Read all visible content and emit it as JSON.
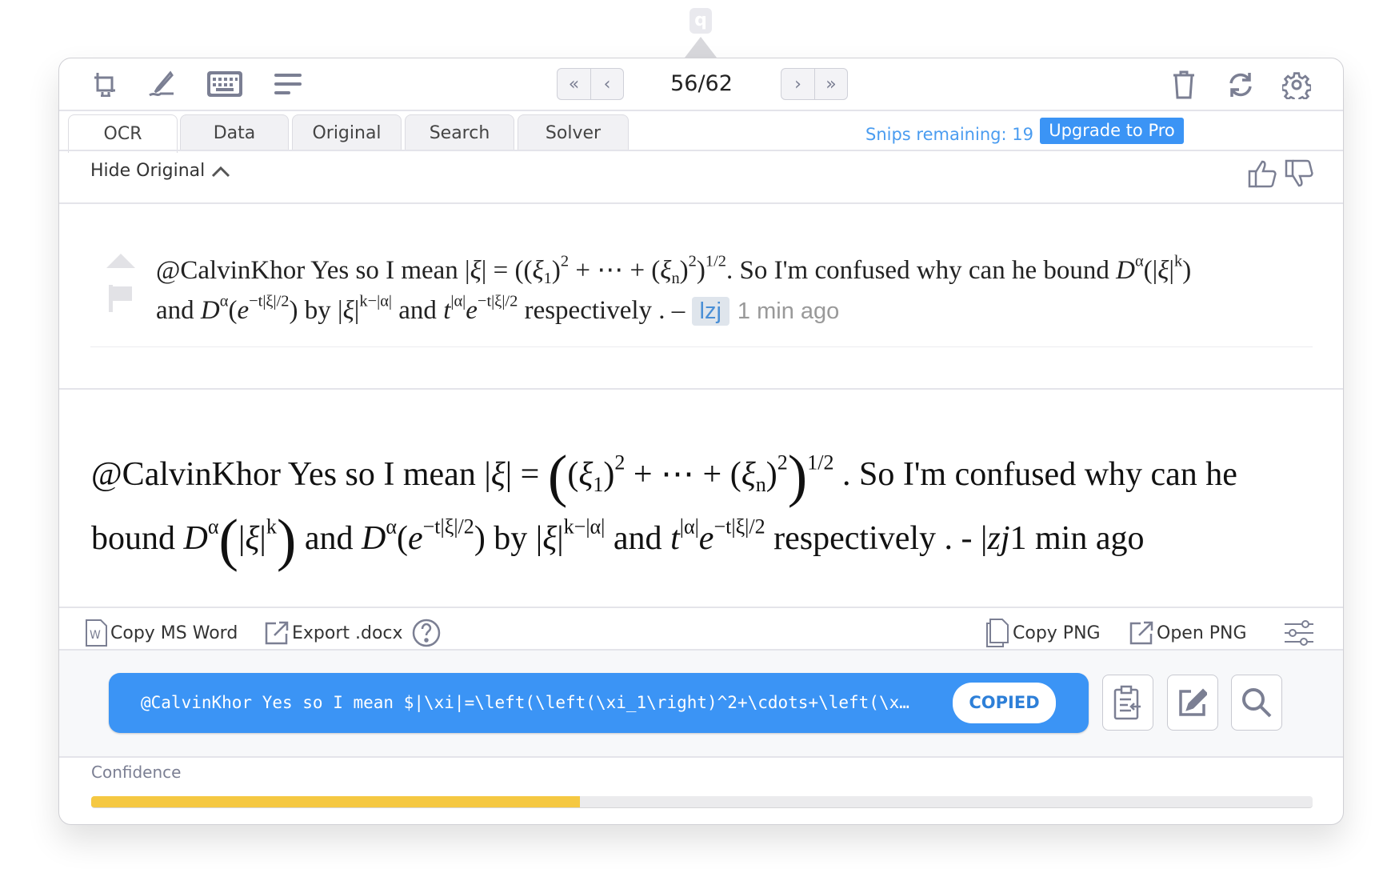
{
  "app": {
    "logo": "q"
  },
  "toolbar": {
    "icons": [
      "snip-screen-icon",
      "draw-pen-icon",
      "keyboard-icon",
      "menu-lines-icon"
    ],
    "page_indicator": "56/62",
    "right_icons": [
      "trash-icon",
      "refresh-icon",
      "gear-icon"
    ]
  },
  "tabs": [
    {
      "label": "OCR",
      "active": true
    },
    {
      "label": "Data"
    },
    {
      "label": "Original"
    },
    {
      "label": "Search"
    },
    {
      "label": "Solver"
    }
  ],
  "account": {
    "snips_remaining": "Snips remaining: 19",
    "upgrade_label": "Upgrade to Pro",
    "accent": "#3b94f5"
  },
  "original_bar": {
    "hide_label": "Hide Original"
  },
  "original": {
    "line1": [
      {
        "k": "t",
        "v": "@CalvinKhor Yes so I mean "
      },
      {
        "k": "t",
        "v": "|"
      },
      {
        "k": "mi",
        "v": "ξ"
      },
      {
        "k": "t",
        "v": "| = (("
      },
      {
        "k": "mi",
        "v": "ξ"
      },
      {
        "k": "sub",
        "v": "1"
      },
      {
        "k": "t",
        "v": ")"
      },
      {
        "k": "sup",
        "v": "2"
      },
      {
        "k": "t",
        "v": " + ⋯ + ("
      },
      {
        "k": "mi",
        "v": "ξ"
      },
      {
        "k": "sub",
        "v": "n"
      },
      {
        "k": "t",
        "v": ")"
      },
      {
        "k": "sup",
        "v": "2"
      },
      {
        "k": "t",
        "v": ")"
      },
      {
        "k": "sup",
        "v": "1/2"
      },
      {
        "k": "t",
        "v": ". So I'm confused why can he bound "
      },
      {
        "k": "mi",
        "v": "D"
      },
      {
        "k": "sup",
        "v": "α"
      },
      {
        "k": "t",
        "v": "(|"
      },
      {
        "k": "mi",
        "v": "ξ"
      },
      {
        "k": "t",
        "v": "|"
      },
      {
        "k": "sup",
        "v": "k"
      },
      {
        "k": "t",
        "v": ")"
      }
    ],
    "line2": [
      {
        "k": "t",
        "v": "and "
      },
      {
        "k": "mi",
        "v": "D"
      },
      {
        "k": "sup",
        "v": "α"
      },
      {
        "k": "t",
        "v": "("
      },
      {
        "k": "mi",
        "v": "e"
      },
      {
        "k": "sup",
        "v": "−t|ξ|/2"
      },
      {
        "k": "t",
        "v": ") by |"
      },
      {
        "k": "mi",
        "v": "ξ"
      },
      {
        "k": "t",
        "v": "|"
      },
      {
        "k": "sup",
        "v": "k−|α|"
      },
      {
        "k": "t",
        "v": " and "
      },
      {
        "k": "mi",
        "v": "t"
      },
      {
        "k": "sup",
        "v": "|α|"
      },
      {
        "k": "mi",
        "v": "e"
      },
      {
        "k": "sup",
        "v": "−t|ξ|/2"
      },
      {
        "k": "t",
        "v": " respectively . – "
      }
    ],
    "user": "lzj",
    "time": "1 min ago"
  },
  "rendered": {
    "line1": [
      {
        "k": "t",
        "v": "@CalvinKhor Yes so I mean |"
      },
      {
        "k": "mi",
        "v": "ξ"
      },
      {
        "k": "t",
        "v": "| = "
      },
      {
        "k": "big",
        "v": "("
      },
      {
        "k": "t",
        "v": "("
      },
      {
        "k": "mi",
        "v": "ξ"
      },
      {
        "k": "sub",
        "v": "1"
      },
      {
        "k": "t",
        "v": ")"
      },
      {
        "k": "sup",
        "v": "2"
      },
      {
        "k": "t",
        "v": " + ⋯ + ("
      },
      {
        "k": "mi",
        "v": "ξ"
      },
      {
        "k": "sub",
        "v": "n"
      },
      {
        "k": "t",
        "v": ")"
      },
      {
        "k": "sup",
        "v": "2"
      },
      {
        "k": "big",
        "v": ")"
      },
      {
        "k": "sup",
        "v": "1/2"
      },
      {
        "k": "t",
        "v": " . So I'm confused why can he"
      }
    ],
    "line2": [
      {
        "k": "t",
        "v": "bound "
      },
      {
        "k": "mi",
        "v": "D"
      },
      {
        "k": "sup",
        "v": "α"
      },
      {
        "k": "big",
        "v": "("
      },
      {
        "k": "t",
        "v": "|"
      },
      {
        "k": "mi",
        "v": "ξ"
      },
      {
        "k": "t",
        "v": "|"
      },
      {
        "k": "sup",
        "v": "k"
      },
      {
        "k": "big",
        "v": ")"
      },
      {
        "k": "t",
        "v": " and "
      },
      {
        "k": "mi",
        "v": "D"
      },
      {
        "k": "sup",
        "v": "α"
      },
      {
        "k": "t",
        "v": "("
      },
      {
        "k": "mi",
        "v": "e"
      },
      {
        "k": "sup",
        "v": "−t|ξ|/2"
      },
      {
        "k": "t",
        "v": ") by |"
      },
      {
        "k": "mi",
        "v": "ξ"
      },
      {
        "k": "t",
        "v": "|"
      },
      {
        "k": "sup",
        "v": "k−|α|"
      },
      {
        "k": "t",
        "v": " and "
      },
      {
        "k": "mi",
        "v": "t"
      },
      {
        "k": "sup",
        "v": "|α|"
      },
      {
        "k": "mi",
        "v": "e"
      },
      {
        "k": "sup",
        "v": "−t|ξ|/2"
      },
      {
        "k": "t",
        "v": " respectively . - |"
      },
      {
        "k": "mi",
        "v": "zj"
      },
      {
        "k": "t",
        "v": "1 min ago"
      }
    ]
  },
  "actions": {
    "copy_word": "Copy MS Word",
    "export_docx": "Export .docx",
    "copy_png": "Copy PNG",
    "open_png": "Open PNG"
  },
  "latex": {
    "value": "@CalvinKhor Yes so I mean $|\\xi|=\\left(\\left(\\xi_1\\right)^2+\\cdots+\\left(\\x…",
    "copied_label": "COPIED"
  },
  "confidence": {
    "label": "Confidence",
    "value": 0.4,
    "color": "#f5c842"
  }
}
